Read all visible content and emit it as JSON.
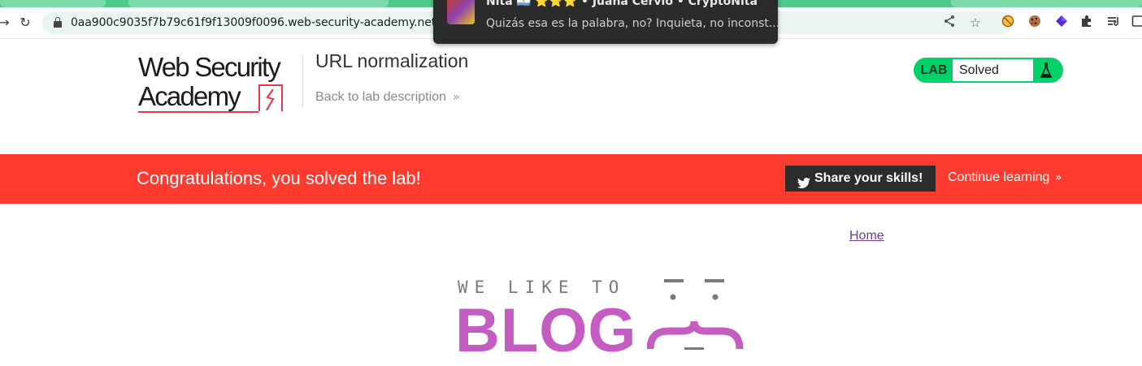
{
  "browser": {
    "url": "0aa900c9035f7b79c61f9f13009f0096.web-security-academy.net",
    "nav_icons": [
      "forward-icon",
      "reload-icon"
    ],
    "omnibox_icons": [
      "share-icon",
      "bookmark-star-icon"
    ],
    "extensions": [
      "blocker-extension-icon",
      "cookie-extension-icon",
      "purple-gem-extension-icon",
      "puzzle-extensions-icon",
      "reading-list-icon",
      "sidepanel-icon"
    ]
  },
  "notification": {
    "title": "Nita 🇦🇷 ⭐⭐⭐ • Juana Cervio • CryptoNita",
    "body": "Quizás esa es la palabra, no?  Inquieta, no inconst..."
  },
  "academy": {
    "logo_line1": "Web Security",
    "logo_line2": "Academy",
    "lab_title": "URL normalization",
    "back_link": "Back to lab description",
    "status_tag": "LAB",
    "status_value": "Solved",
    "colors": {
      "status_green": "#00d26a",
      "brand_red": "#e8384f"
    }
  },
  "banner": {
    "message": "Congratulations, you solved the lab!",
    "share_label": "Share your skills!",
    "continue_label": "Continue learning",
    "color": "#ff3b30"
  },
  "blog": {
    "home_link": "Home",
    "tagline": "WE LIKE TO",
    "headline": "BLOG",
    "colors": {
      "headline": "#c45cc1"
    }
  }
}
